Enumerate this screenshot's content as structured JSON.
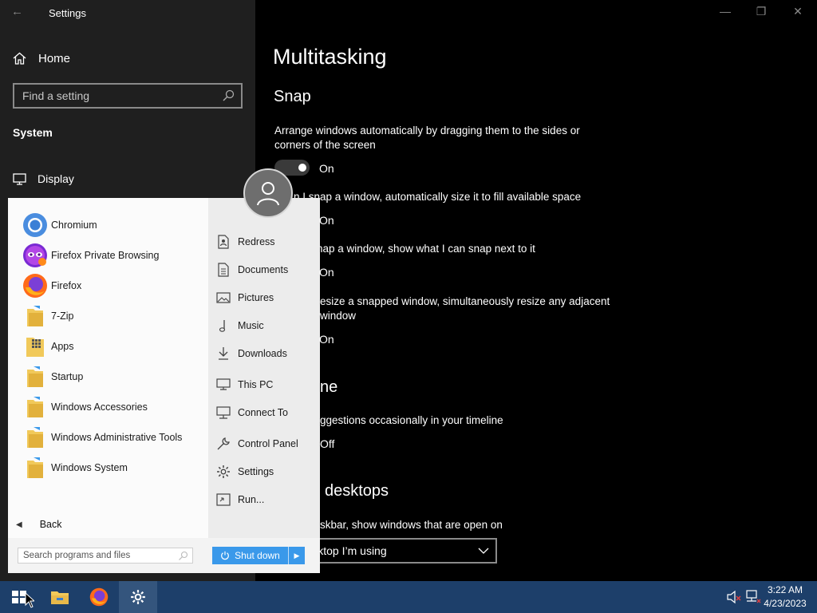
{
  "window": {
    "title": "Settings",
    "back_glyph": "←",
    "minimize_glyph": "—",
    "restore_glyph": "❐",
    "close_glyph": "✕"
  },
  "nav": {
    "home_label": "Home",
    "search_placeholder": "Find a setting",
    "section_label": "System",
    "display_label": "Display"
  },
  "content": {
    "page_title": "Multitasking",
    "snap_heading": "Snap",
    "snap_option_1": "Arrange windows automatically by dragging them to the sides or corners of the screen",
    "snap_option_1_state": "On",
    "snap_option_2": "n I snap a window, automatically size it to fill available space",
    "snap_option_2_state": "On",
    "snap_option_3": "nap a window, show what I can snap next to it",
    "snap_option_3_state": "On",
    "snap_option_4": "esize a snapped window, simultaneously resize any adjacent window",
    "snap_option_4_state": "On",
    "timeline_heading": "ne",
    "timeline_option": "ggestions occasionally in your timeline",
    "timeline_option_state": "Off",
    "desktops_heading": "desktops",
    "desktops_option": "skbar, show windows that are open on",
    "desktops_dropdown_value": "e desktop I’m using"
  },
  "start_menu": {
    "programs": [
      {
        "label": "Chromium",
        "icon": "chromium-icon"
      },
      {
        "label": "Firefox Private Browsing",
        "icon": "firefox-private-icon"
      },
      {
        "label": "Firefox",
        "icon": "firefox-icon"
      },
      {
        "label": "7-Zip",
        "icon": "folder-icon"
      },
      {
        "label": "Apps",
        "icon": "apps-folder-icon"
      },
      {
        "label": "Startup",
        "icon": "folder-icon"
      },
      {
        "label": "Windows Accessories",
        "icon": "folder-icon"
      },
      {
        "label": "Windows Administrative Tools",
        "icon": "folder-icon"
      },
      {
        "label": "Windows System",
        "icon": "folder-icon"
      }
    ],
    "places": [
      {
        "label": "Redress",
        "icon": "user-folder-icon"
      },
      {
        "label": "Documents",
        "icon": "document-icon"
      },
      {
        "label": "Pictures",
        "icon": "picture-icon"
      },
      {
        "label": "Music",
        "icon": "music-icon"
      },
      {
        "label": "Downloads",
        "icon": "download-icon"
      },
      {
        "label": "This PC",
        "icon": "computer-icon"
      },
      {
        "label": "Connect To",
        "icon": "connect-icon"
      },
      {
        "label": "Control Panel",
        "icon": "wrench-icon"
      },
      {
        "label": "Settings",
        "icon": "gear-icon"
      },
      {
        "label": "Run...",
        "icon": "run-icon"
      }
    ],
    "back_label": "Back",
    "search_placeholder": "Search programs and files",
    "shutdown_label": "Shut down"
  },
  "taskbar": {
    "time": "3:22 AM",
    "date": "4/23/2023"
  },
  "colors": {
    "taskbar": "#1d3f6a",
    "accent": "#3a99ea"
  }
}
